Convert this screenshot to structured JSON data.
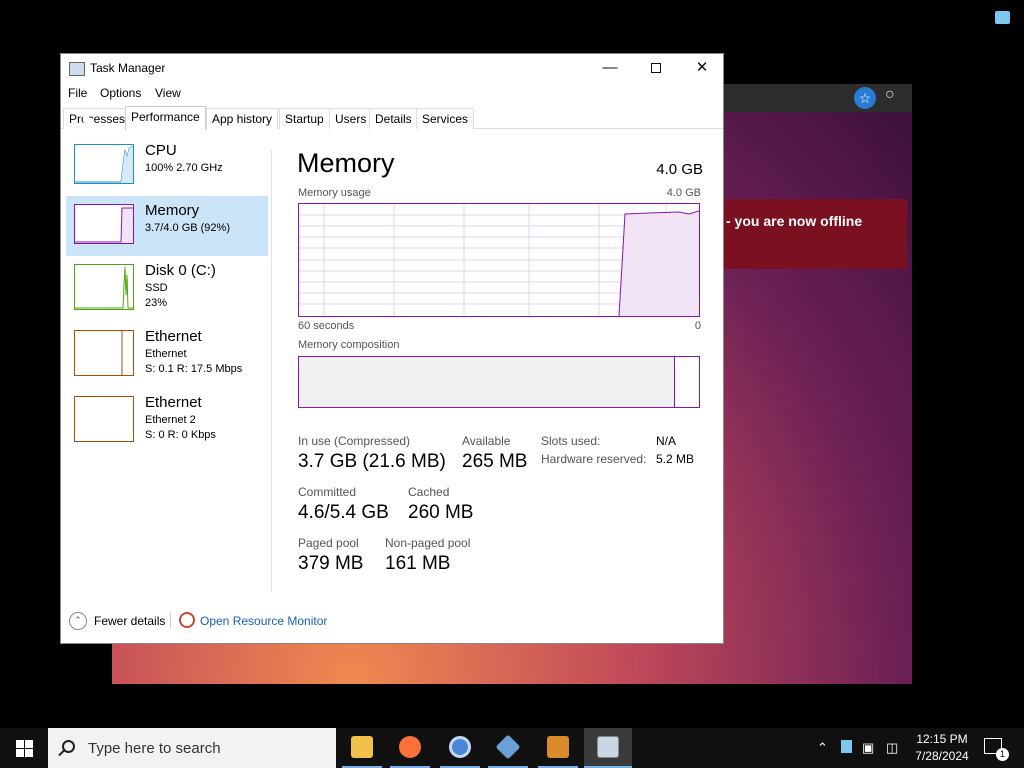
{
  "window": {
    "title": "Task Manager"
  },
  "menu": [
    "File",
    "Options",
    "View"
  ],
  "tabs": [
    "Processes",
    "Performance",
    "App history",
    "Startup",
    "Users",
    "Details",
    "Services"
  ],
  "perf_items": [
    {
      "name": "CPU",
      "line1": "100%  2.70 GHz",
      "line2": "",
      "color": "#1f8dc6"
    },
    {
      "name": "Memory",
      "line1": "3.7/4.0 GB (92%)",
      "line2": "",
      "color": "#8b12ae"
    },
    {
      "name": "Disk 0 (C:)",
      "line1": "SSD",
      "line2": "23%",
      "color": "#4da60c"
    },
    {
      "name": "Ethernet",
      "line1": "Ethernet",
      "line2": "S: 0.1  R: 17.5 Mbps",
      "color": "#a74f01"
    },
    {
      "name": "Ethernet",
      "line1": "Ethernet 2",
      "line2": "S: 0  R: 0 Kbps",
      "color": "#a74f01"
    }
  ],
  "memory": {
    "title": "Memory",
    "total": "4.0 GB",
    "usage_label": "Memory usage",
    "usage_max": "4.0 GB",
    "time_left": "60 seconds",
    "time_right": "0",
    "composition_label": "Memory composition",
    "composition_used_fraction": 0.94,
    "in_use_label": "In use (Compressed)",
    "in_use_value": "3.7 GB (21.6 MB)",
    "available_label": "Available",
    "available_value": "265 MB",
    "committed_label": "Committed",
    "committed_value": "4.6/5.4 GB",
    "cached_label": "Cached",
    "cached_value": "260 MB",
    "paged_label": "Paged pool",
    "paged_value": "379 MB",
    "nonpaged_label": "Non-paged pool",
    "nonpaged_value": "161 MB",
    "slots_label": "Slots used:",
    "slots_value": "N/A",
    "hw_label": "Hardware reserved:",
    "hw_value": "5.2 MB"
  },
  "footer": {
    "fewer_details": "Fewer details",
    "resource_monitor": "Open Resource Monitor"
  },
  "background_window": {
    "notice": "- you are now offline"
  },
  "taskbar": {
    "search_placeholder": "Type here to search",
    "apps": [
      "file-explorer",
      "firefox",
      "chromium",
      "virtualbox",
      "app",
      "task-manager"
    ],
    "time": "12:15 PM",
    "date": "7/28/2024",
    "notification_count": "1"
  }
}
